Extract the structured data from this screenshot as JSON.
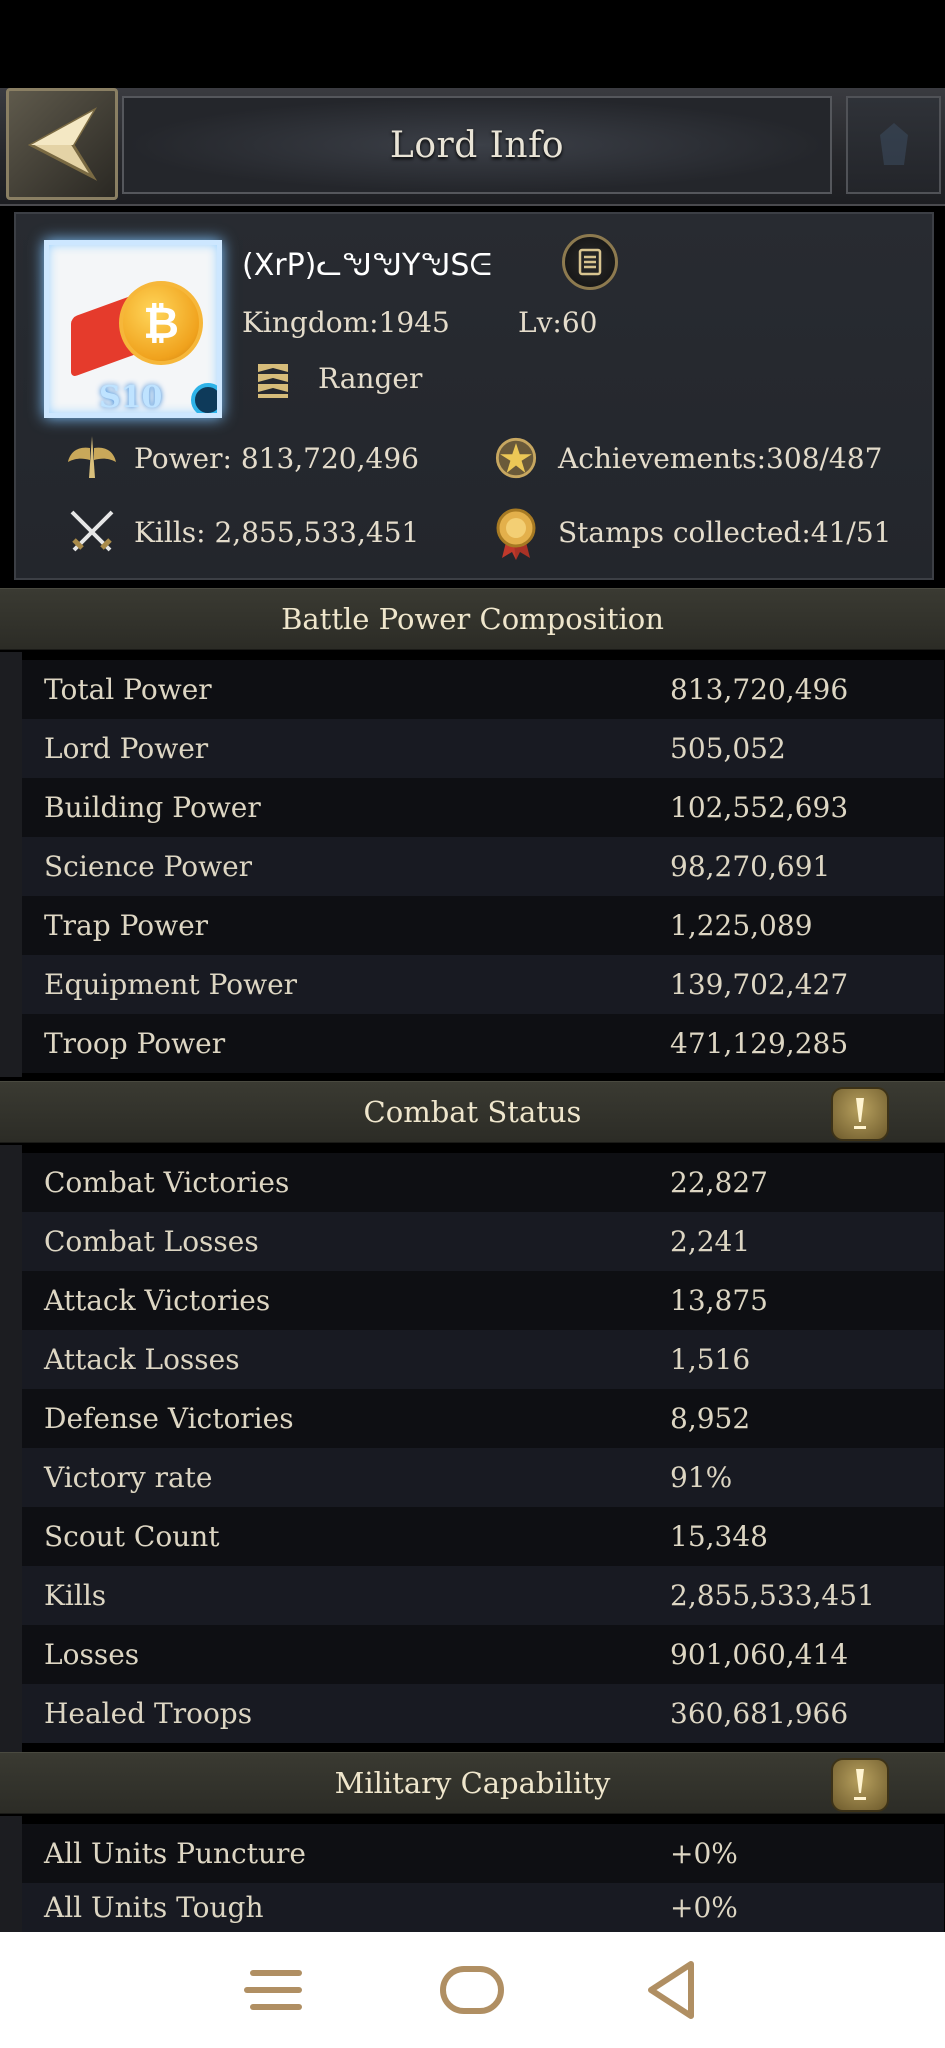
{
  "header": {
    "title": "Lord Info"
  },
  "profile": {
    "name": "(XrP)ᓚᖑᖑYᖑSᕮ",
    "kingdom": "Kingdom:1945",
    "level": "Lv:60",
    "rank": "Ranger",
    "avatar_badge": "S10",
    "power": "Power: 813,720,496",
    "achievements": "Achievements:308/487",
    "kills": "Kills: 2,855,533,451",
    "stamps": "Stamps collected:41/51"
  },
  "battle_power": {
    "title": "Battle Power Composition",
    "rows": [
      {
        "label": "Total Power",
        "value": "813,720,496"
      },
      {
        "label": "Lord Power",
        "value": "505,052"
      },
      {
        "label": "Building Power",
        "value": "102,552,693"
      },
      {
        "label": "Science Power",
        "value": "98,270,691"
      },
      {
        "label": "Trap Power",
        "value": "1,225,089"
      },
      {
        "label": "Equipment Power",
        "value": "139,702,427"
      },
      {
        "label": "Troop Power",
        "value": "471,129,285"
      }
    ]
  },
  "combat_status": {
    "title": "Combat Status",
    "rows": [
      {
        "label": "Combat Victories",
        "value": "22,827"
      },
      {
        "label": "Combat Losses",
        "value": "2,241"
      },
      {
        "label": "Attack Victories",
        "value": "13,875"
      },
      {
        "label": "Attack Losses",
        "value": "1,516"
      },
      {
        "label": "Defense Victories",
        "value": "8,952"
      },
      {
        "label": "Victory rate",
        "value": "91%"
      },
      {
        "label": "Scout Count",
        "value": "15,348"
      },
      {
        "label": "Kills",
        "value": "2,855,533,451"
      },
      {
        "label": "Losses",
        "value": "901,060,414"
      },
      {
        "label": "Healed Troops",
        "value": "360,681,966"
      }
    ]
  },
  "military": {
    "title": "Military Capability",
    "rows": [
      {
        "label": "All Units Puncture",
        "value": "+0%"
      },
      {
        "label": "All Units Tough",
        "value": "+0%"
      }
    ]
  },
  "colors": {
    "section_header": "#2f2f29",
    "row_dark": "#0e0f13",
    "row_light": "#181a22",
    "toggle_gold": "#b7a05e",
    "navbar_icon": "#b08f63"
  }
}
